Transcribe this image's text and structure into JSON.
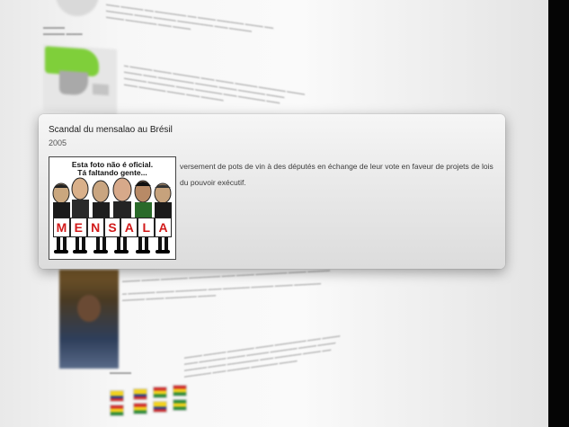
{
  "popup": {
    "title": "Scandal du mensalao au Brésil",
    "year": "2005",
    "description": "versement de pots de vin à des députés en échange de leur vote en faveur de projets de lois du pouvoir exécutif.",
    "image": {
      "caption_line1": "Esta foto não é oficial.",
      "caption_line2": "Tá faltando gente...",
      "letters": [
        "M",
        "E",
        "N",
        "S",
        "A",
        "L",
        "A"
      ]
    }
  }
}
